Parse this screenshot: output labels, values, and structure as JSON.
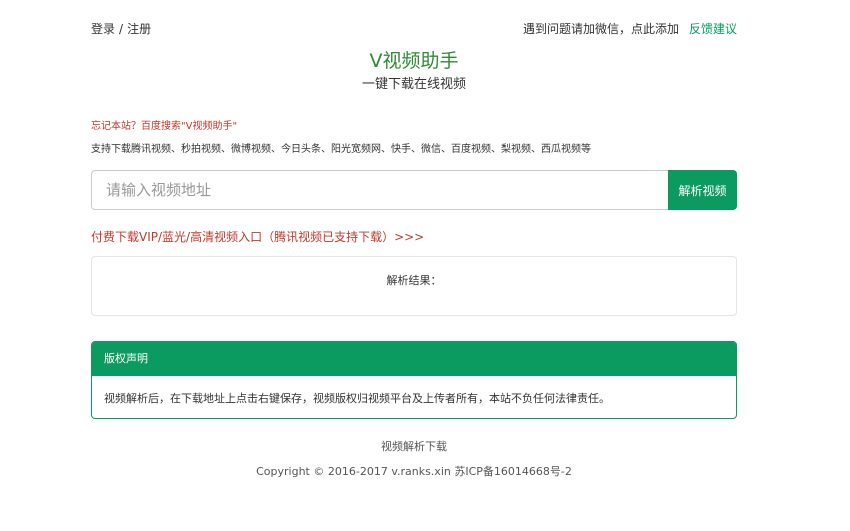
{
  "topbar": {
    "login": "登录",
    "separator": "/",
    "register": "注册",
    "help_text": "遇到问题请加微信，点此添加",
    "feedback": "反馈建议"
  },
  "header": {
    "title": "V视频助手",
    "subtitle": "一键下载在线视频"
  },
  "notices": {
    "bookmark_hint": "忘记本站？百度搜索\"V视频助手\"",
    "supported_sites": "支持下载腾讯视频、秒拍视频、微博视频、今日头条、阳光宽频网、快手、微信、百度视频、梨视频、西瓜视频等"
  },
  "search": {
    "placeholder": "请输入视频地址",
    "value": "",
    "button_label": "解析视频"
  },
  "vip_link": "付费下载VIP/蓝光/高清视频入口（腾讯视频已支持下载）>>>",
  "result": {
    "label": "解析结果："
  },
  "copyright": {
    "heading": "版权声明",
    "body": "视频解析后，在下载地址上点击右键保存，视频版权归视频平台及上传者所有，本站不负任何法律责任。"
  },
  "footer": {
    "link": "视频解析下载",
    "copyright": "Copyright © 2016-2017 v.ranks.xin 苏ICP备16014668号-2"
  },
  "colors": {
    "accent": "#0b9b60",
    "title": "#2e8b33",
    "warning": "#c0392b"
  }
}
